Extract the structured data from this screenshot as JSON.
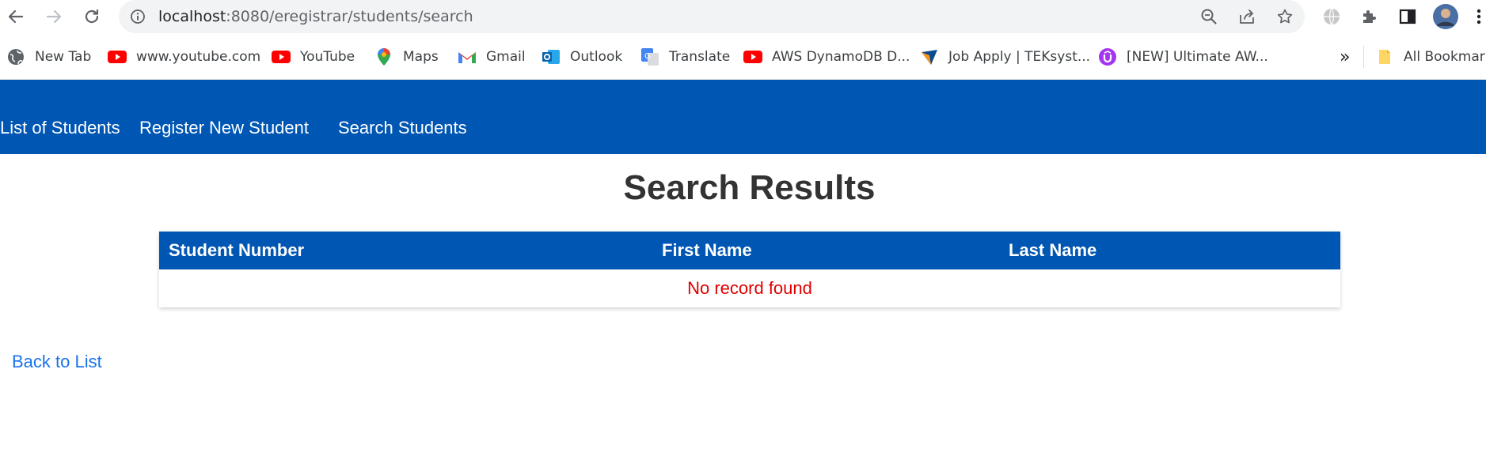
{
  "browser": {
    "url_host": "localhost",
    "url_rest": ":8080/eregistrar/students/search",
    "bookmarks": [
      {
        "label": "New Tab",
        "icon": "globe-icon"
      },
      {
        "label": "www.youtube.com",
        "icon": "youtube-icon"
      },
      {
        "label": "YouTube",
        "icon": "youtube-icon"
      },
      {
        "label": "Maps",
        "icon": "maps-pin-icon"
      },
      {
        "label": "Gmail",
        "icon": "gmail-icon"
      },
      {
        "label": "Outlook",
        "icon": "outlook-icon"
      },
      {
        "label": "Translate",
        "icon": "translate-icon"
      },
      {
        "label": "AWS DynamoDB D...",
        "icon": "youtube-icon"
      },
      {
        "label": "Job Apply | TEKsyst...",
        "icon": "teksystems-icon"
      },
      {
        "label": "[NEW] Ultimate AW...",
        "icon": "udemy-icon"
      }
    ],
    "overflow_label": "»",
    "all_bookmarks_label": "All Bookmarks"
  },
  "nav": {
    "list_label": "List of Students",
    "register_label": "Register New Student",
    "search_label": "Search Students"
  },
  "page": {
    "title": "Search Results",
    "columns": [
      "Student Number",
      "First Name",
      "Last Name"
    ],
    "empty_message": "No record found",
    "back_link": "Back to List"
  },
  "colors": {
    "primary": "#0056b3",
    "empty_text": "#e00000",
    "link": "#1a73e8",
    "title": "#333333"
  }
}
